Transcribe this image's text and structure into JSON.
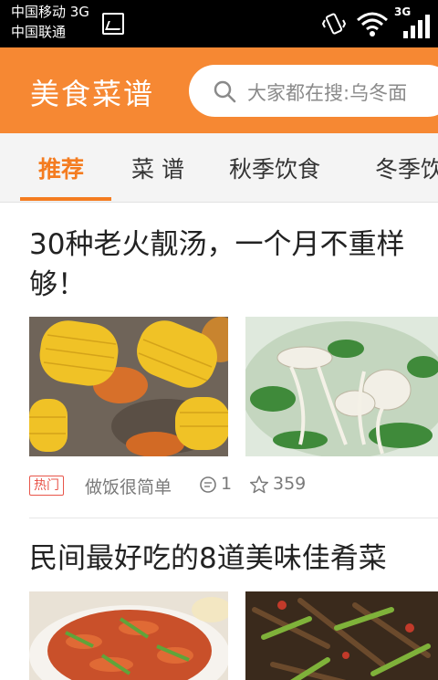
{
  "status_bar": {
    "carrier1": "中国移动 3G",
    "carrier2": "中国联通",
    "network_label": "3G",
    "icons": [
      "gallery-notification-icon",
      "vibrate-icon",
      "wifi-icon",
      "signal-icon"
    ]
  },
  "header": {
    "app_title": "美食菜谱",
    "search_placeholder": "大家都在搜:乌冬面",
    "accent_color": "#f68833"
  },
  "tabs": [
    {
      "label": "推荐",
      "active": true
    },
    {
      "label": "菜 谱",
      "active": false
    },
    {
      "label": "秋季饮食",
      "active": false
    },
    {
      "label": "冬季饮",
      "active": false
    }
  ],
  "feed": [
    {
      "title_line1": "30种老火靓汤，一个月不重样",
      "title_line2": "够！",
      "images": [
        "corn-carrot-soup-photo",
        "mushroom-greens-soup-photo"
      ],
      "badge": "热门",
      "author": "做饭很简单",
      "comments": "1",
      "favorites": "359"
    },
    {
      "title_line1": "民间最好吃的8道美味佳肴菜",
      "images": [
        "fried-shrimp-dish-photo",
        "stir-fried-vegetable-dish-photo"
      ]
    }
  ]
}
